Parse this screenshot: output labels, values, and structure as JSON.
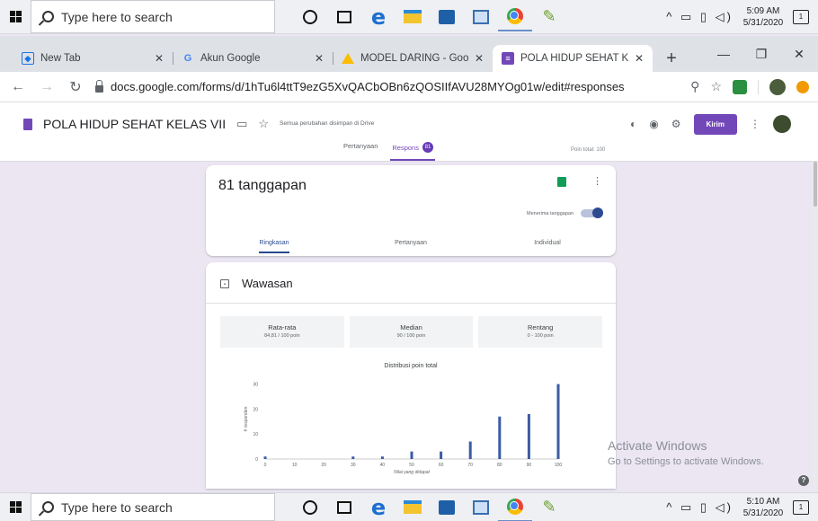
{
  "taskbar": {
    "search_placeholder": "Type here to search",
    "top_time": "5:09 AM",
    "top_date": "5/31/2020",
    "bottom_time": "5:10 AM",
    "bottom_date": "5/31/2020",
    "notification_count": "1",
    "apps": [
      "cortana-icon",
      "task-view-icon",
      "edge-icon",
      "file-explorer-icon",
      "store-icon",
      "photos-icon",
      "chrome-icon",
      "paint-icon"
    ]
  },
  "browser": {
    "tabs": [
      {
        "label": "New Tab",
        "icon": "new-tab-icon"
      },
      {
        "label": "Akun Google",
        "icon": "google-icon"
      },
      {
        "label": "MODEL DARING - Googl",
        "icon": "drive-icon"
      },
      {
        "label": "POLA HIDUP SEHAT KELA",
        "icon": "forms-icon"
      }
    ],
    "url": "docs.google.com/forms/d/1hTu6l4ttT9ezG5XvQACbOBn6zQOSIIfAVU28MYOg01w/edit#responses"
  },
  "form": {
    "title": "POLA HIDUP SEHAT KELAS VII",
    "save_status": "Semua perubahan disimpan di Drive",
    "send_label": "Kirim",
    "tab_questions": "Pertanyaan",
    "tab_responses": "Respons",
    "responses_badge": "81",
    "points_total": "Poin total: 100",
    "accent_color": "#7248b9"
  },
  "responses": {
    "count_label": "81 tanggapan",
    "accepting_label": "Menerima tanggapan",
    "accepting": true,
    "subtabs": [
      "Ringkasan",
      "Pertanyaan",
      "Individual"
    ]
  },
  "insights": {
    "title": "Wawasan",
    "stats": [
      {
        "label": "Rata-rata",
        "value": "84,81 / 100 poin"
      },
      {
        "label": "Median",
        "value": "90 / 100 poin"
      },
      {
        "label": "Rentang",
        "value": "0 - 100 poin"
      }
    ]
  },
  "chart_data": {
    "type": "bar",
    "title": "Distribusi poin total",
    "xlabel": "Nilai yang didapat",
    "ylabel": "# responden",
    "x": [
      0,
      30,
      40,
      50,
      60,
      70,
      80,
      90,
      100
    ],
    "values": [
      1,
      1,
      1,
      3,
      3,
      7,
      17,
      18,
      30
    ],
    "xticks": [
      0,
      10,
      20,
      30,
      40,
      50,
      60,
      70,
      80,
      90,
      100
    ],
    "yticks": [
      0,
      10,
      20,
      30
    ],
    "xlim": [
      0,
      100
    ],
    "ylim": [
      0,
      32
    ],
    "bar_color": "#3b5ba5",
    "grid": false
  },
  "watermark": {
    "line1": "Activate Windows",
    "line2": "Go to Settings to activate Windows."
  }
}
